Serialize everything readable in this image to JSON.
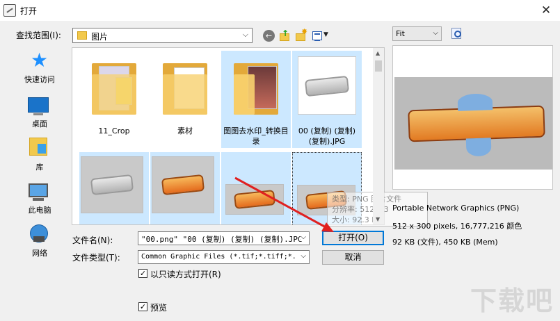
{
  "window": {
    "title": "打开"
  },
  "lookin": {
    "label": "查找范围(I):",
    "value": "图片"
  },
  "preview_controls": {
    "fit": "Fit"
  },
  "places": [
    {
      "label": "快速访问",
      "icon": "star-icon"
    },
    {
      "label": "桌面",
      "icon": "desktop-icon"
    },
    {
      "label": "库",
      "icon": "library-icon"
    },
    {
      "label": "此电脑",
      "icon": "computer-icon"
    },
    {
      "label": "网络",
      "icon": "network-icon"
    }
  ],
  "files": [
    {
      "name": "11_Crop",
      "kind": "folder",
      "selected": false
    },
    {
      "name": "素材",
      "kind": "folder",
      "selected": false
    },
    {
      "name": "图图去水印_转换目录",
      "kind": "folder",
      "selected": true
    },
    {
      "name": "00 (复制) (复制) (复制).JPG",
      "kind": "image",
      "selected": true
    },
    {
      "name": "",
      "kind": "image",
      "selected": true
    },
    {
      "name": "",
      "kind": "image",
      "selected": true
    },
    {
      "name": "",
      "kind": "image",
      "selected": true
    },
    {
      "name": "",
      "kind": "image",
      "selected": true
    }
  ],
  "tooltip": {
    "line1": "类型: PNG 图片文件",
    "line2": "分辨率: 512 x 3",
    "line3": "大小: 92.3 KB"
  },
  "preview": {
    "format": "Portable Network Graphics (PNG)",
    "dimensions": "512 x 300 pixels, 16,777,216 颜色",
    "size": "92 KB (文件), 450 KB (Mem)"
  },
  "filename": {
    "label": "文件名(N):",
    "value": "\"00.png\" \"00 (复制) (复制) (复制).JPG"
  },
  "filetype": {
    "label": "文件类型(T):",
    "value": "Common Graphic Files (*.tif;*.tiff;*."
  },
  "buttons": {
    "open": "打开(O)",
    "cancel": "取消"
  },
  "readonly": {
    "label": "以只读方式打开(R)",
    "checked": true
  },
  "preview_toggle": {
    "label": "预览",
    "checked": true
  },
  "watermark": "下载吧",
  "colors": {
    "selection": "#cce8ff",
    "accent": "#0078d7",
    "annotation_arrow": "#e02020"
  }
}
